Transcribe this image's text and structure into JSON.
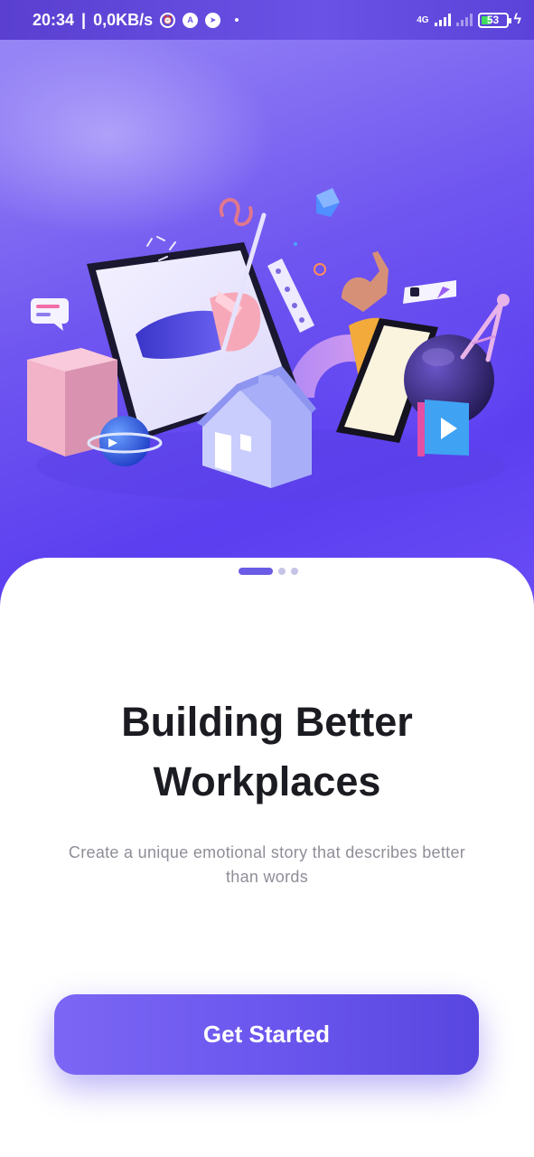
{
  "status_bar": {
    "time": "20:34",
    "separator": "|",
    "speed": "0,0KB/s",
    "network_type": "4G",
    "battery": "53",
    "icons": [
      "alarm-icon",
      "app-a-icon",
      "telegram-icon",
      "notification-dot-icon",
      "signal-icon",
      "signal-2-icon",
      "battery-icon",
      "charging-icon"
    ]
  },
  "hero": {
    "illustration": "3d-workspace-illustration"
  },
  "pager": {
    "total": 3,
    "active_index": 0
  },
  "onboarding": {
    "title": "Building Better Workplaces",
    "subtitle": "Create a unique emotional story that describes better than words",
    "cta_label": "Get Started"
  },
  "colors": {
    "accent": "#6b57ee",
    "title": "#1b1b22",
    "subtitle": "#8e8e98",
    "hero_bg": "#6f55f0"
  }
}
